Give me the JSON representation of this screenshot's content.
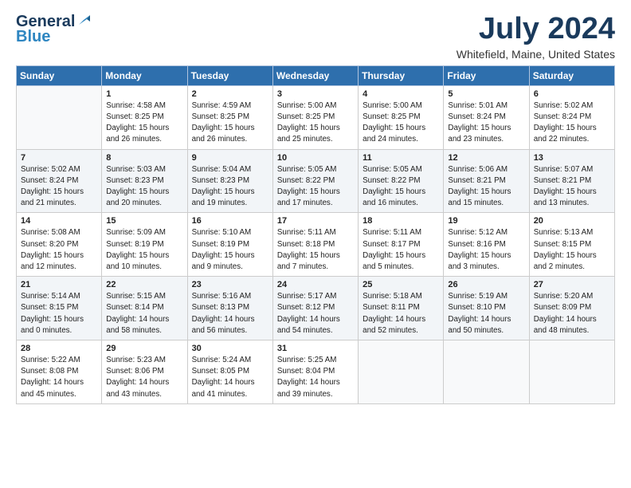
{
  "header": {
    "logo_line1": "General",
    "logo_line2": "Blue",
    "month": "July 2024",
    "location": "Whitefield, Maine, United States"
  },
  "weekdays": [
    "Sunday",
    "Monday",
    "Tuesday",
    "Wednesday",
    "Thursday",
    "Friday",
    "Saturday"
  ],
  "weeks": [
    [
      {
        "day": "",
        "info": ""
      },
      {
        "day": "1",
        "info": "Sunrise: 4:58 AM\nSunset: 8:25 PM\nDaylight: 15 hours\nand 26 minutes."
      },
      {
        "day": "2",
        "info": "Sunrise: 4:59 AM\nSunset: 8:25 PM\nDaylight: 15 hours\nand 26 minutes."
      },
      {
        "day": "3",
        "info": "Sunrise: 5:00 AM\nSunset: 8:25 PM\nDaylight: 15 hours\nand 25 minutes."
      },
      {
        "day": "4",
        "info": "Sunrise: 5:00 AM\nSunset: 8:25 PM\nDaylight: 15 hours\nand 24 minutes."
      },
      {
        "day": "5",
        "info": "Sunrise: 5:01 AM\nSunset: 8:24 PM\nDaylight: 15 hours\nand 23 minutes."
      },
      {
        "day": "6",
        "info": "Sunrise: 5:02 AM\nSunset: 8:24 PM\nDaylight: 15 hours\nand 22 minutes."
      }
    ],
    [
      {
        "day": "7",
        "info": "Sunrise: 5:02 AM\nSunset: 8:24 PM\nDaylight: 15 hours\nand 21 minutes."
      },
      {
        "day": "8",
        "info": "Sunrise: 5:03 AM\nSunset: 8:23 PM\nDaylight: 15 hours\nand 20 minutes."
      },
      {
        "day": "9",
        "info": "Sunrise: 5:04 AM\nSunset: 8:23 PM\nDaylight: 15 hours\nand 19 minutes."
      },
      {
        "day": "10",
        "info": "Sunrise: 5:05 AM\nSunset: 8:22 PM\nDaylight: 15 hours\nand 17 minutes."
      },
      {
        "day": "11",
        "info": "Sunrise: 5:05 AM\nSunset: 8:22 PM\nDaylight: 15 hours\nand 16 minutes."
      },
      {
        "day": "12",
        "info": "Sunrise: 5:06 AM\nSunset: 8:21 PM\nDaylight: 15 hours\nand 15 minutes."
      },
      {
        "day": "13",
        "info": "Sunrise: 5:07 AM\nSunset: 8:21 PM\nDaylight: 15 hours\nand 13 minutes."
      }
    ],
    [
      {
        "day": "14",
        "info": "Sunrise: 5:08 AM\nSunset: 8:20 PM\nDaylight: 15 hours\nand 12 minutes."
      },
      {
        "day": "15",
        "info": "Sunrise: 5:09 AM\nSunset: 8:19 PM\nDaylight: 15 hours\nand 10 minutes."
      },
      {
        "day": "16",
        "info": "Sunrise: 5:10 AM\nSunset: 8:19 PM\nDaylight: 15 hours\nand 9 minutes."
      },
      {
        "day": "17",
        "info": "Sunrise: 5:11 AM\nSunset: 8:18 PM\nDaylight: 15 hours\nand 7 minutes."
      },
      {
        "day": "18",
        "info": "Sunrise: 5:11 AM\nSunset: 8:17 PM\nDaylight: 15 hours\nand 5 minutes."
      },
      {
        "day": "19",
        "info": "Sunrise: 5:12 AM\nSunset: 8:16 PM\nDaylight: 15 hours\nand 3 minutes."
      },
      {
        "day": "20",
        "info": "Sunrise: 5:13 AM\nSunset: 8:15 PM\nDaylight: 15 hours\nand 2 minutes."
      }
    ],
    [
      {
        "day": "21",
        "info": "Sunrise: 5:14 AM\nSunset: 8:15 PM\nDaylight: 15 hours\nand 0 minutes."
      },
      {
        "day": "22",
        "info": "Sunrise: 5:15 AM\nSunset: 8:14 PM\nDaylight: 14 hours\nand 58 minutes."
      },
      {
        "day": "23",
        "info": "Sunrise: 5:16 AM\nSunset: 8:13 PM\nDaylight: 14 hours\nand 56 minutes."
      },
      {
        "day": "24",
        "info": "Sunrise: 5:17 AM\nSunset: 8:12 PM\nDaylight: 14 hours\nand 54 minutes."
      },
      {
        "day": "25",
        "info": "Sunrise: 5:18 AM\nSunset: 8:11 PM\nDaylight: 14 hours\nand 52 minutes."
      },
      {
        "day": "26",
        "info": "Sunrise: 5:19 AM\nSunset: 8:10 PM\nDaylight: 14 hours\nand 50 minutes."
      },
      {
        "day": "27",
        "info": "Sunrise: 5:20 AM\nSunset: 8:09 PM\nDaylight: 14 hours\nand 48 minutes."
      }
    ],
    [
      {
        "day": "28",
        "info": "Sunrise: 5:22 AM\nSunset: 8:08 PM\nDaylight: 14 hours\nand 45 minutes."
      },
      {
        "day": "29",
        "info": "Sunrise: 5:23 AM\nSunset: 8:06 PM\nDaylight: 14 hours\nand 43 minutes."
      },
      {
        "day": "30",
        "info": "Sunrise: 5:24 AM\nSunset: 8:05 PM\nDaylight: 14 hours\nand 41 minutes."
      },
      {
        "day": "31",
        "info": "Sunrise: 5:25 AM\nSunset: 8:04 PM\nDaylight: 14 hours\nand 39 minutes."
      },
      {
        "day": "",
        "info": ""
      },
      {
        "day": "",
        "info": ""
      },
      {
        "day": "",
        "info": ""
      }
    ]
  ]
}
